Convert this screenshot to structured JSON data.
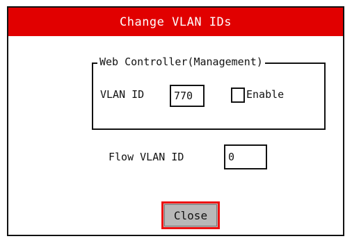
{
  "dialog": {
    "title": "Change VLAN IDs",
    "title_bar_color": "#e10000",
    "focus_color": "#ee1111"
  },
  "management_group": {
    "legend": "Web Controller(Management)",
    "vlan_label": "VLAN ID",
    "vlan_value": "770",
    "enable_label": "Enable",
    "enable_checked": false
  },
  "flow": {
    "label": "Flow VLAN ID",
    "value": "0"
  },
  "buttons": {
    "close_label": "Close"
  }
}
